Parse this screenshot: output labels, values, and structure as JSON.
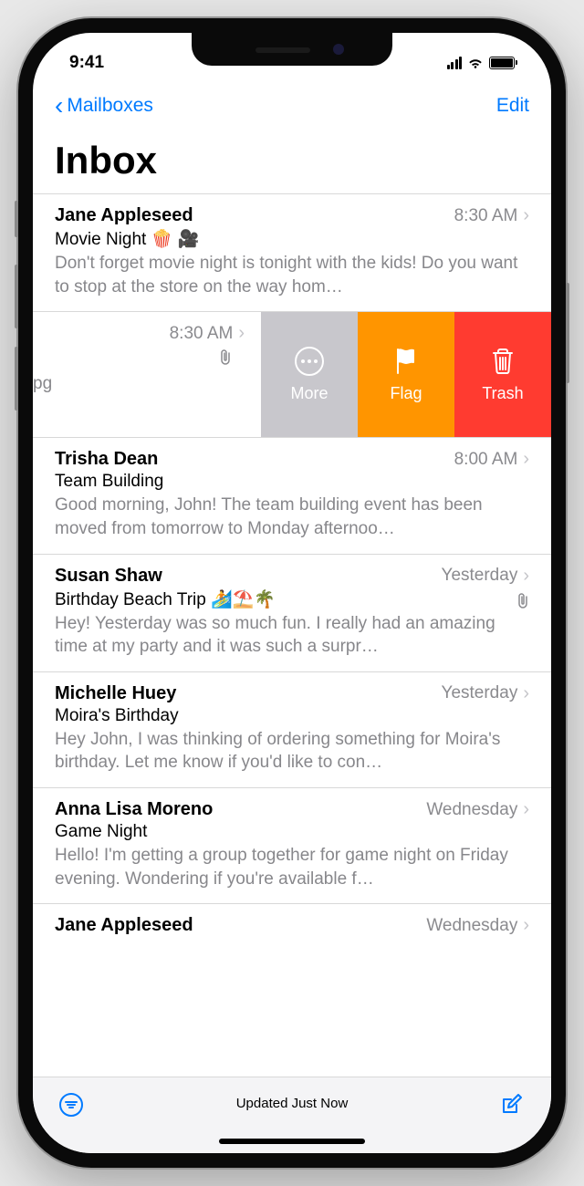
{
  "statusBar": {
    "time": "9:41"
  },
  "nav": {
    "back": "Mailboxes",
    "edit": "Edit"
  },
  "pageTitle": "Inbox",
  "swipeActions": {
    "more": "More",
    "flag": "Flag",
    "trash": "Trash"
  },
  "swipeRow": {
    "time": "8:30 AM",
    "hint": "pg"
  },
  "toolbar": {
    "status": "Updated Just Now"
  },
  "messages": [
    {
      "sender": "Jane Appleseed",
      "time": "8:30 AM",
      "subject": "Movie Night 🍿 🎥",
      "preview": "Don't forget movie night is tonight with the kids! Do you want to stop at the store on the way hom…",
      "attachment": false
    },
    {
      "sender": "Trisha Dean",
      "time": "8:00 AM",
      "subject": "Team Building",
      "preview": "Good morning, John! The team building event has been moved from tomorrow to Monday afternoo…",
      "attachment": false
    },
    {
      "sender": "Susan Shaw",
      "time": "Yesterday",
      "subject": "Birthday Beach Trip 🏄⛱️🌴",
      "preview": "Hey! Yesterday was so much fun. I really had an amazing time at my party and it was such a surpr…",
      "attachment": true
    },
    {
      "sender": "Michelle Huey",
      "time": "Yesterday",
      "subject": "Moira's Birthday",
      "preview": "Hey John, I was thinking of ordering something for Moira's birthday. Let me know if you'd like to con…",
      "attachment": false
    },
    {
      "sender": "Anna Lisa Moreno",
      "time": "Wednesday",
      "subject": "Game Night",
      "preview": "Hello! I'm getting a group together for game night on Friday evening. Wondering if you're available f…",
      "attachment": false
    },
    {
      "sender": "Jane Appleseed",
      "time": "Wednesday",
      "subject": "",
      "preview": "",
      "attachment": false
    }
  ]
}
